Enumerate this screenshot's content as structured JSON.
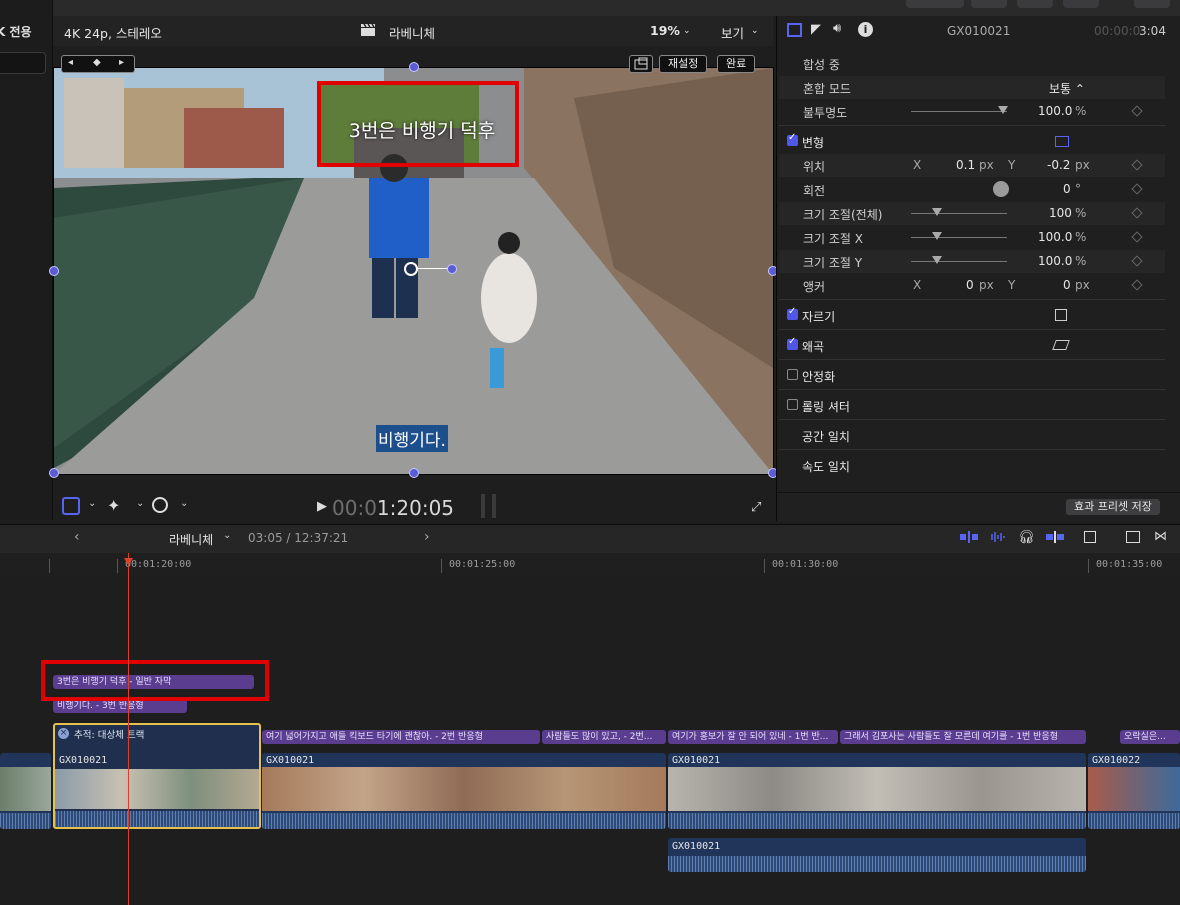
{
  "left_panel": {
    "label": "K 전용"
  },
  "viewer_header": {
    "format": "4K 24p, 스테레오",
    "project_name": "라베니체",
    "zoom": "19%",
    "view_menu": "보기"
  },
  "viewer": {
    "title_text": "3번은 비행기 덕후",
    "subtitle_text": "비행기다.",
    "reset_button": "재설정",
    "done_button": "완료"
  },
  "playback": {
    "timecode_dim": "00:0",
    "timecode_bright": "1:20:05"
  },
  "inspector": {
    "clip_name": "GX010021",
    "duration_dim": "00:00:0",
    "duration_bright": "3:04",
    "compositing": "합성 중",
    "blend_mode_label": "혼합 모드",
    "blend_mode_value": "보통 ⌃",
    "opacity_label": "불투명도",
    "opacity_value": "100.0",
    "percent": "%",
    "transform_label": "변형",
    "position_label": "위치",
    "x_label": "X",
    "y_label": "Y",
    "px": "px",
    "position_x": "0.1",
    "position_y": "-0.2",
    "rotation_label": "회전",
    "rotation_value": "0",
    "degree": "°",
    "scale_all_label": "크기 조절(전체)",
    "scale_all_value": "100",
    "scale_x_label": "크기 조절 X",
    "scale_x_value": "100.0",
    "scale_y_label": "크기 조절 Y",
    "scale_y_value": "100.0",
    "anchor_label": "앵커",
    "anchor_x": "0",
    "anchor_y": "0",
    "crop_label": "자르기",
    "distort_label": "왜곡",
    "stabilize_label": "안정화",
    "rolling_shutter_label": "롤링 셔터",
    "spatial_conform_label": "공간 일치",
    "rate_conform_label": "속도 일치",
    "save_preset_button": "효과 프리셋 저장"
  },
  "timeline": {
    "project_name": "라베니체",
    "position": "03:05 / 12:37:21",
    "ruler_ticks": [
      "00:01:20:00",
      "00:01:25:00",
      "00:01:30:00",
      "00:01:35:00"
    ],
    "title_clips": [
      "3번은 비행기 덕후 - 일반 자막",
      "비행기다. - 3번 반응형",
      "여기 넓어가지고 애들 킥보드 타기에 괜찮아. - 2번 반응형",
      "사람들도 많이 있고, - 2번...",
      "여기가 홍보가 잘 안 되어 있네 - 1번 반...",
      "그래서 김포사는 사람들도 잘 모른데 여기를 - 1번 반응형",
      "오락실은..."
    ],
    "tracking_label": "추적: 대상체 트랙",
    "video_clips": [
      "GX010021",
      "GX010021",
      "GX010021",
      "GX010022",
      "GX010021"
    ]
  }
}
